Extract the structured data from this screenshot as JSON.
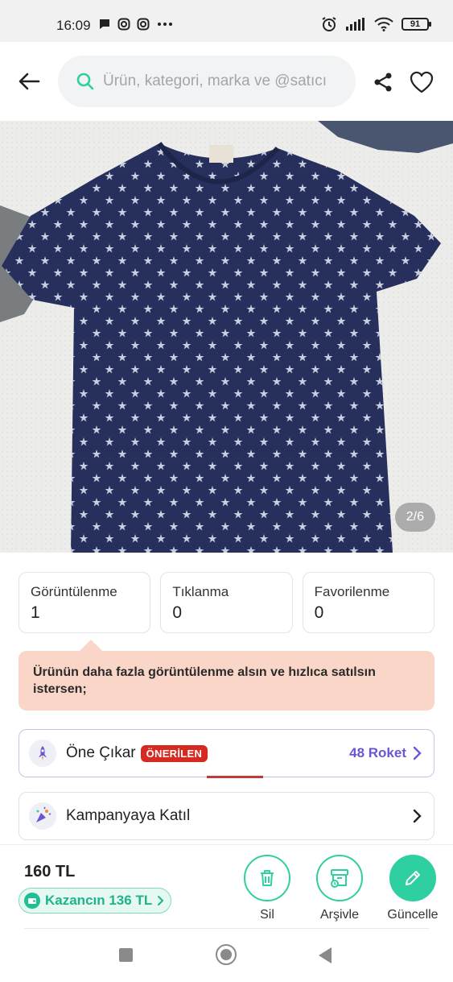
{
  "status_bar": {
    "time": "16:09",
    "left_icons": [
      "chat-bubble-icon",
      "instagram-icon",
      "instagram-icon",
      "more-dots-icon"
    ],
    "right_icons": [
      "alarm-icon",
      "signal-icon",
      "wifi-icon",
      "battery-icon"
    ],
    "battery_level": "91"
  },
  "header": {
    "search_placeholder": "Ürün, kategori, marka ve @satıcı"
  },
  "product": {
    "image_counter": "2/6"
  },
  "stats": [
    {
      "label": "Görüntülenme",
      "value": "1"
    },
    {
      "label": "Tıklanma",
      "value": "0"
    },
    {
      "label": "Favorilenme",
      "value": "0"
    }
  ],
  "tip": {
    "text": "Ürünün daha fazla görüntülenme alsın ve hızlıca satılsın istersen;"
  },
  "promote": {
    "title": "Öne Çıkar",
    "badge": "ÖNERİLEN",
    "price": "48 Roket"
  },
  "campaign": {
    "title": "Kampanyaya Katıl"
  },
  "bottom": {
    "price": "160 TL",
    "earnings": "Kazancın 136 TL",
    "actions": [
      {
        "label": "Sil"
      },
      {
        "label": "Arşivle"
      },
      {
        "label": "Güncelle"
      }
    ]
  },
  "colors": {
    "accent": "#2ecfa0",
    "tip_bg": "#f9d6c7",
    "badge": "#d6291f",
    "roket": "#6b55d6"
  }
}
